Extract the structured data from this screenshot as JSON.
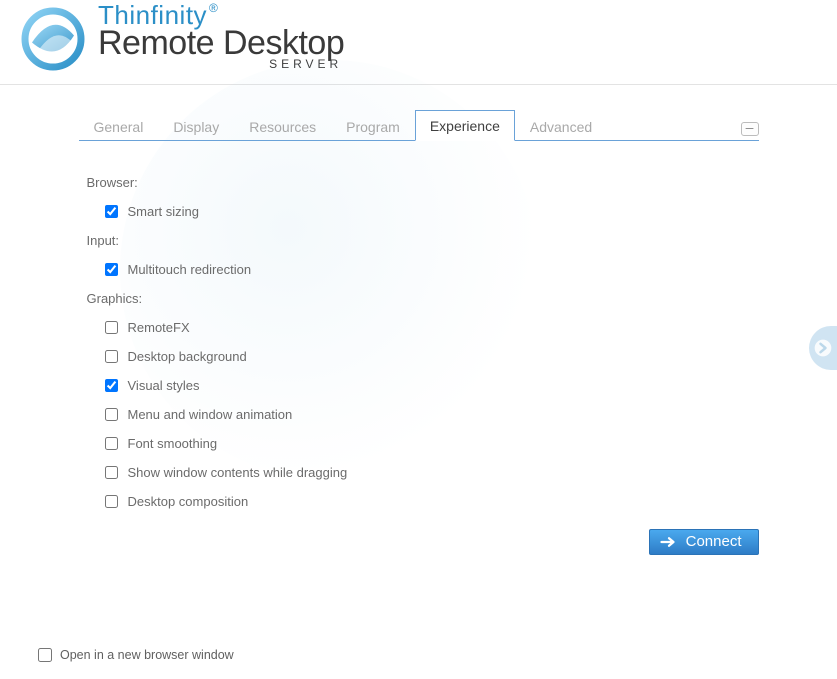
{
  "brand": {
    "line1": "Thinfinity",
    "line2": "Remote Desktop",
    "line3": "SERVER"
  },
  "tabs": {
    "general": "General",
    "display": "Display",
    "resources": "Resources",
    "program": "Program",
    "experience": "Experience",
    "advanced": "Advanced"
  },
  "experience": {
    "browser_label": "Browser:",
    "smart_sizing": {
      "label": "Smart sizing",
      "checked": true
    },
    "input_label": "Input:",
    "multitouch": {
      "label": "Multitouch redirection",
      "checked": true
    },
    "graphics_label": "Graphics:",
    "remotefx": {
      "label": "RemoteFX",
      "checked": false
    },
    "desktop_bg": {
      "label": "Desktop background",
      "checked": false
    },
    "visual_styles": {
      "label": "Visual styles",
      "checked": true
    },
    "menu_anim": {
      "label": "Menu and window animation",
      "checked": false
    },
    "font_smoothing": {
      "label": "Font smoothing",
      "checked": false
    },
    "show_drag": {
      "label": "Show window contents while dragging",
      "checked": false
    },
    "desktop_comp": {
      "label": "Desktop composition",
      "checked": false
    }
  },
  "connect_label": "Connect",
  "footer": {
    "new_window": {
      "label": "Open in a new browser window",
      "checked": false
    }
  },
  "collapse_glyph": "–"
}
